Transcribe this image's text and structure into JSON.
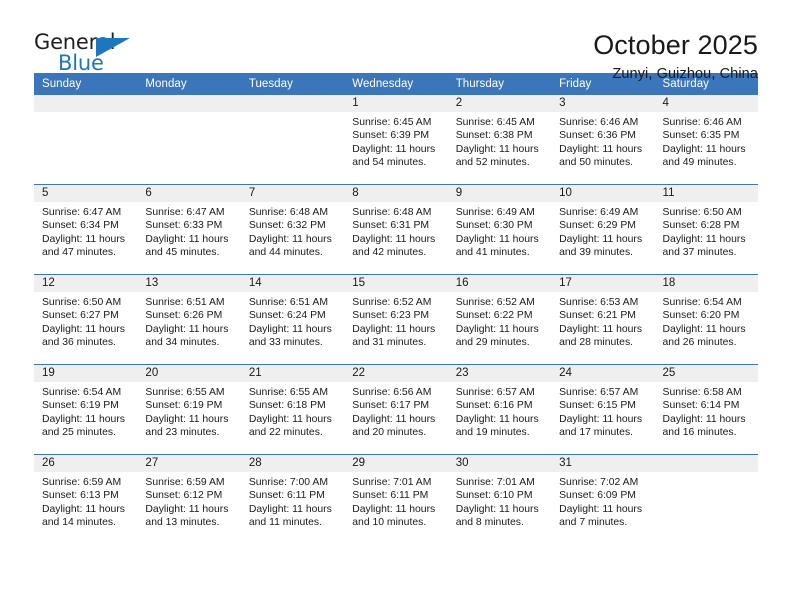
{
  "logo": {
    "primary_text": "General",
    "secondary_text": "Blue",
    "icon": "flag-triangle-icon",
    "primary_color": "#231f20",
    "secondary_color": "#1e76bd"
  },
  "header": {
    "title": "October 2025",
    "location": "Zunyi, Guizhou, China"
  },
  "theme": {
    "header_blue": "#3b76bb",
    "date_band_gray": "#efefef",
    "text_color": "#1a1a1a",
    "background": "#ffffff"
  },
  "calendar": {
    "weekday_headers": [
      "Sunday",
      "Monday",
      "Tuesday",
      "Wednesday",
      "Thursday",
      "Friday",
      "Saturday"
    ],
    "labels": {
      "sunrise_prefix": "Sunrise:",
      "sunset_prefix": "Sunset:",
      "daylight_prefix": "Daylight:"
    },
    "weeks": [
      [
        {
          "day": "",
          "empty": true
        },
        {
          "day": "",
          "empty": true
        },
        {
          "day": "",
          "empty": true
        },
        {
          "day": "1",
          "sunrise": "Sunrise: 6:45 AM",
          "sunset": "Sunset: 6:39 PM",
          "daylight_line1": "Daylight: 11 hours",
          "daylight_line2": "and 54 minutes."
        },
        {
          "day": "2",
          "sunrise": "Sunrise: 6:45 AM",
          "sunset": "Sunset: 6:38 PM",
          "daylight_line1": "Daylight: 11 hours",
          "daylight_line2": "and 52 minutes."
        },
        {
          "day": "3",
          "sunrise": "Sunrise: 6:46 AM",
          "sunset": "Sunset: 6:36 PM",
          "daylight_line1": "Daylight: 11 hours",
          "daylight_line2": "and 50 minutes."
        },
        {
          "day": "4",
          "sunrise": "Sunrise: 6:46 AM",
          "sunset": "Sunset: 6:35 PM",
          "daylight_line1": "Daylight: 11 hours",
          "daylight_line2": "and 49 minutes."
        }
      ],
      [
        {
          "day": "5",
          "sunrise": "Sunrise: 6:47 AM",
          "sunset": "Sunset: 6:34 PM",
          "daylight_line1": "Daylight: 11 hours",
          "daylight_line2": "and 47 minutes."
        },
        {
          "day": "6",
          "sunrise": "Sunrise: 6:47 AM",
          "sunset": "Sunset: 6:33 PM",
          "daylight_line1": "Daylight: 11 hours",
          "daylight_line2": "and 45 minutes."
        },
        {
          "day": "7",
          "sunrise": "Sunrise: 6:48 AM",
          "sunset": "Sunset: 6:32 PM",
          "daylight_line1": "Daylight: 11 hours",
          "daylight_line2": "and 44 minutes."
        },
        {
          "day": "8",
          "sunrise": "Sunrise: 6:48 AM",
          "sunset": "Sunset: 6:31 PM",
          "daylight_line1": "Daylight: 11 hours",
          "daylight_line2": "and 42 minutes."
        },
        {
          "day": "9",
          "sunrise": "Sunrise: 6:49 AM",
          "sunset": "Sunset: 6:30 PM",
          "daylight_line1": "Daylight: 11 hours",
          "daylight_line2": "and 41 minutes."
        },
        {
          "day": "10",
          "sunrise": "Sunrise: 6:49 AM",
          "sunset": "Sunset: 6:29 PM",
          "daylight_line1": "Daylight: 11 hours",
          "daylight_line2": "and 39 minutes."
        },
        {
          "day": "11",
          "sunrise": "Sunrise: 6:50 AM",
          "sunset": "Sunset: 6:28 PM",
          "daylight_line1": "Daylight: 11 hours",
          "daylight_line2": "and 37 minutes."
        }
      ],
      [
        {
          "day": "12",
          "sunrise": "Sunrise: 6:50 AM",
          "sunset": "Sunset: 6:27 PM",
          "daylight_line1": "Daylight: 11 hours",
          "daylight_line2": "and 36 minutes."
        },
        {
          "day": "13",
          "sunrise": "Sunrise: 6:51 AM",
          "sunset": "Sunset: 6:26 PM",
          "daylight_line1": "Daylight: 11 hours",
          "daylight_line2": "and 34 minutes."
        },
        {
          "day": "14",
          "sunrise": "Sunrise: 6:51 AM",
          "sunset": "Sunset: 6:24 PM",
          "daylight_line1": "Daylight: 11 hours",
          "daylight_line2": "and 33 minutes."
        },
        {
          "day": "15",
          "sunrise": "Sunrise: 6:52 AM",
          "sunset": "Sunset: 6:23 PM",
          "daylight_line1": "Daylight: 11 hours",
          "daylight_line2": "and 31 minutes."
        },
        {
          "day": "16",
          "sunrise": "Sunrise: 6:52 AM",
          "sunset": "Sunset: 6:22 PM",
          "daylight_line1": "Daylight: 11 hours",
          "daylight_line2": "and 29 minutes."
        },
        {
          "day": "17",
          "sunrise": "Sunrise: 6:53 AM",
          "sunset": "Sunset: 6:21 PM",
          "daylight_line1": "Daylight: 11 hours",
          "daylight_line2": "and 28 minutes."
        },
        {
          "day": "18",
          "sunrise": "Sunrise: 6:54 AM",
          "sunset": "Sunset: 6:20 PM",
          "daylight_line1": "Daylight: 11 hours",
          "daylight_line2": "and 26 minutes."
        }
      ],
      [
        {
          "day": "19",
          "sunrise": "Sunrise: 6:54 AM",
          "sunset": "Sunset: 6:19 PM",
          "daylight_line1": "Daylight: 11 hours",
          "daylight_line2": "and 25 minutes."
        },
        {
          "day": "20",
          "sunrise": "Sunrise: 6:55 AM",
          "sunset": "Sunset: 6:19 PM",
          "daylight_line1": "Daylight: 11 hours",
          "daylight_line2": "and 23 minutes."
        },
        {
          "day": "21",
          "sunrise": "Sunrise: 6:55 AM",
          "sunset": "Sunset: 6:18 PM",
          "daylight_line1": "Daylight: 11 hours",
          "daylight_line2": "and 22 minutes."
        },
        {
          "day": "22",
          "sunrise": "Sunrise: 6:56 AM",
          "sunset": "Sunset: 6:17 PM",
          "daylight_line1": "Daylight: 11 hours",
          "daylight_line2": "and 20 minutes."
        },
        {
          "day": "23",
          "sunrise": "Sunrise: 6:57 AM",
          "sunset": "Sunset: 6:16 PM",
          "daylight_line1": "Daylight: 11 hours",
          "daylight_line2": "and 19 minutes."
        },
        {
          "day": "24",
          "sunrise": "Sunrise: 6:57 AM",
          "sunset": "Sunset: 6:15 PM",
          "daylight_line1": "Daylight: 11 hours",
          "daylight_line2": "and 17 minutes."
        },
        {
          "day": "25",
          "sunrise": "Sunrise: 6:58 AM",
          "sunset": "Sunset: 6:14 PM",
          "daylight_line1": "Daylight: 11 hours",
          "daylight_line2": "and 16 minutes."
        }
      ],
      [
        {
          "day": "26",
          "sunrise": "Sunrise: 6:59 AM",
          "sunset": "Sunset: 6:13 PM",
          "daylight_line1": "Daylight: 11 hours",
          "daylight_line2": "and 14 minutes."
        },
        {
          "day": "27",
          "sunrise": "Sunrise: 6:59 AM",
          "sunset": "Sunset: 6:12 PM",
          "daylight_line1": "Daylight: 11 hours",
          "daylight_line2": "and 13 minutes."
        },
        {
          "day": "28",
          "sunrise": "Sunrise: 7:00 AM",
          "sunset": "Sunset: 6:11 PM",
          "daylight_line1": "Daylight: 11 hours",
          "daylight_line2": "and 11 minutes."
        },
        {
          "day": "29",
          "sunrise": "Sunrise: 7:01 AM",
          "sunset": "Sunset: 6:11 PM",
          "daylight_line1": "Daylight: 11 hours",
          "daylight_line2": "and 10 minutes."
        },
        {
          "day": "30",
          "sunrise": "Sunrise: 7:01 AM",
          "sunset": "Sunset: 6:10 PM",
          "daylight_line1": "Daylight: 11 hours",
          "daylight_line2": "and 8 minutes."
        },
        {
          "day": "31",
          "sunrise": "Sunrise: 7:02 AM",
          "sunset": "Sunset: 6:09 PM",
          "daylight_line1": "Daylight: 11 hours",
          "daylight_line2": "and 7 minutes."
        },
        {
          "day": "",
          "empty": true
        }
      ]
    ]
  }
}
